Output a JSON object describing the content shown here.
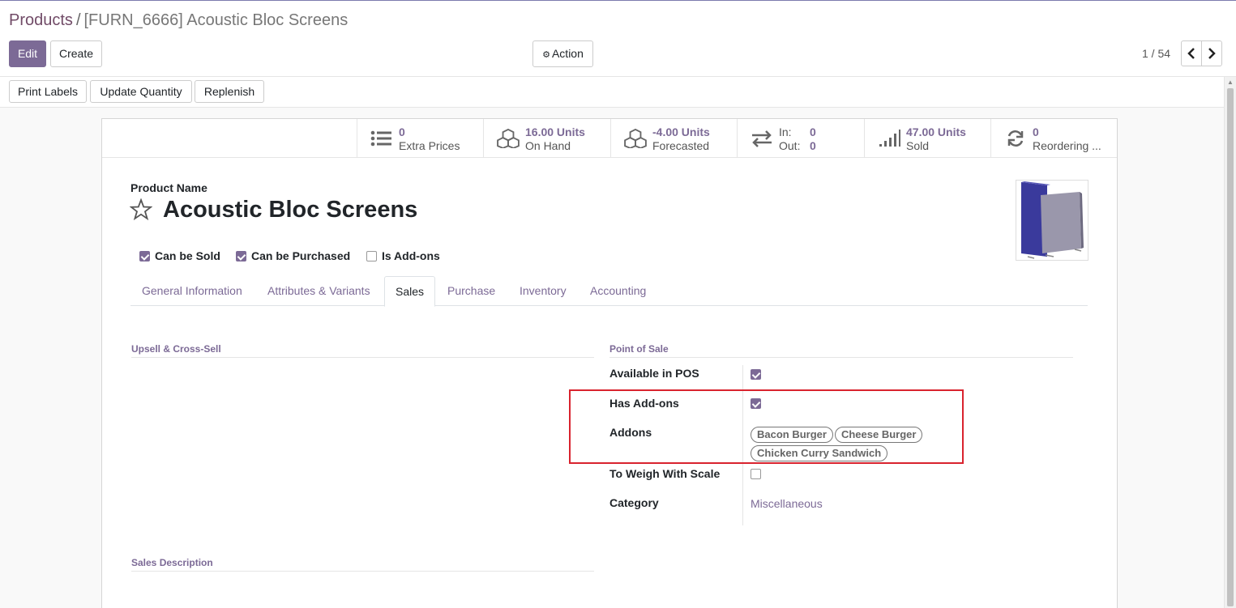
{
  "breadcrumb": {
    "parent": "Products",
    "separator": "/",
    "current": "[FURN_6666] Acoustic Bloc Screens"
  },
  "control": {
    "edit_label": "Edit",
    "create_label": "Create",
    "action_label": "Action",
    "pager_text": "1 / 54",
    "prev_label": "‹",
    "next_label": "›"
  },
  "header_buttons": {
    "print_labels": "Print Labels",
    "update_quantity": "Update Quantity",
    "replenish": "Replenish"
  },
  "smart_buttons": [
    {
      "icon": "list-icon",
      "value": "0",
      "label": "Extra Prices"
    },
    {
      "icon": "cubes-icon",
      "value": "16.00 Units",
      "label": "On Hand"
    },
    {
      "icon": "cubes-icon",
      "value": "-4.00 Units",
      "label": "Forecasted"
    },
    {
      "icon": "exchange-icon",
      "in_label": "In:",
      "in_value": "0",
      "out_label": "Out:",
      "out_value": "0"
    },
    {
      "icon": "signal-icon",
      "value": "47.00 Units",
      "label": "Sold"
    },
    {
      "icon": "refresh-icon",
      "value": "0",
      "label": "Reordering ..."
    }
  ],
  "product": {
    "name_label": "Product Name",
    "name": "Acoustic Bloc Screens",
    "can_be_sold": "Can be Sold",
    "can_be_purchased": "Can be Purchased",
    "is_addons": "Is Add-ons"
  },
  "tabs": [
    "General Information",
    "Attributes & Variants",
    "Sales",
    "Purchase",
    "Inventory",
    "Accounting"
  ],
  "active_tab": "Sales",
  "sales": {
    "upsell_title": "Upsell & Cross-Sell",
    "pos_title": "Point of Sale",
    "available_in_pos": "Available in POS",
    "has_addons": "Has Add-ons",
    "addons_label": "Addons",
    "addons": [
      "Bacon Burger",
      "Cheese Burger",
      "Chicken Curry Sandwich"
    ],
    "to_weigh": "To Weigh With Scale",
    "category_label": "Category",
    "category_value": "Miscellaneous",
    "sales_description_title": "Sales Description"
  },
  "colors": {
    "brand": "#7c6a96",
    "highlight": "#d9232e"
  }
}
